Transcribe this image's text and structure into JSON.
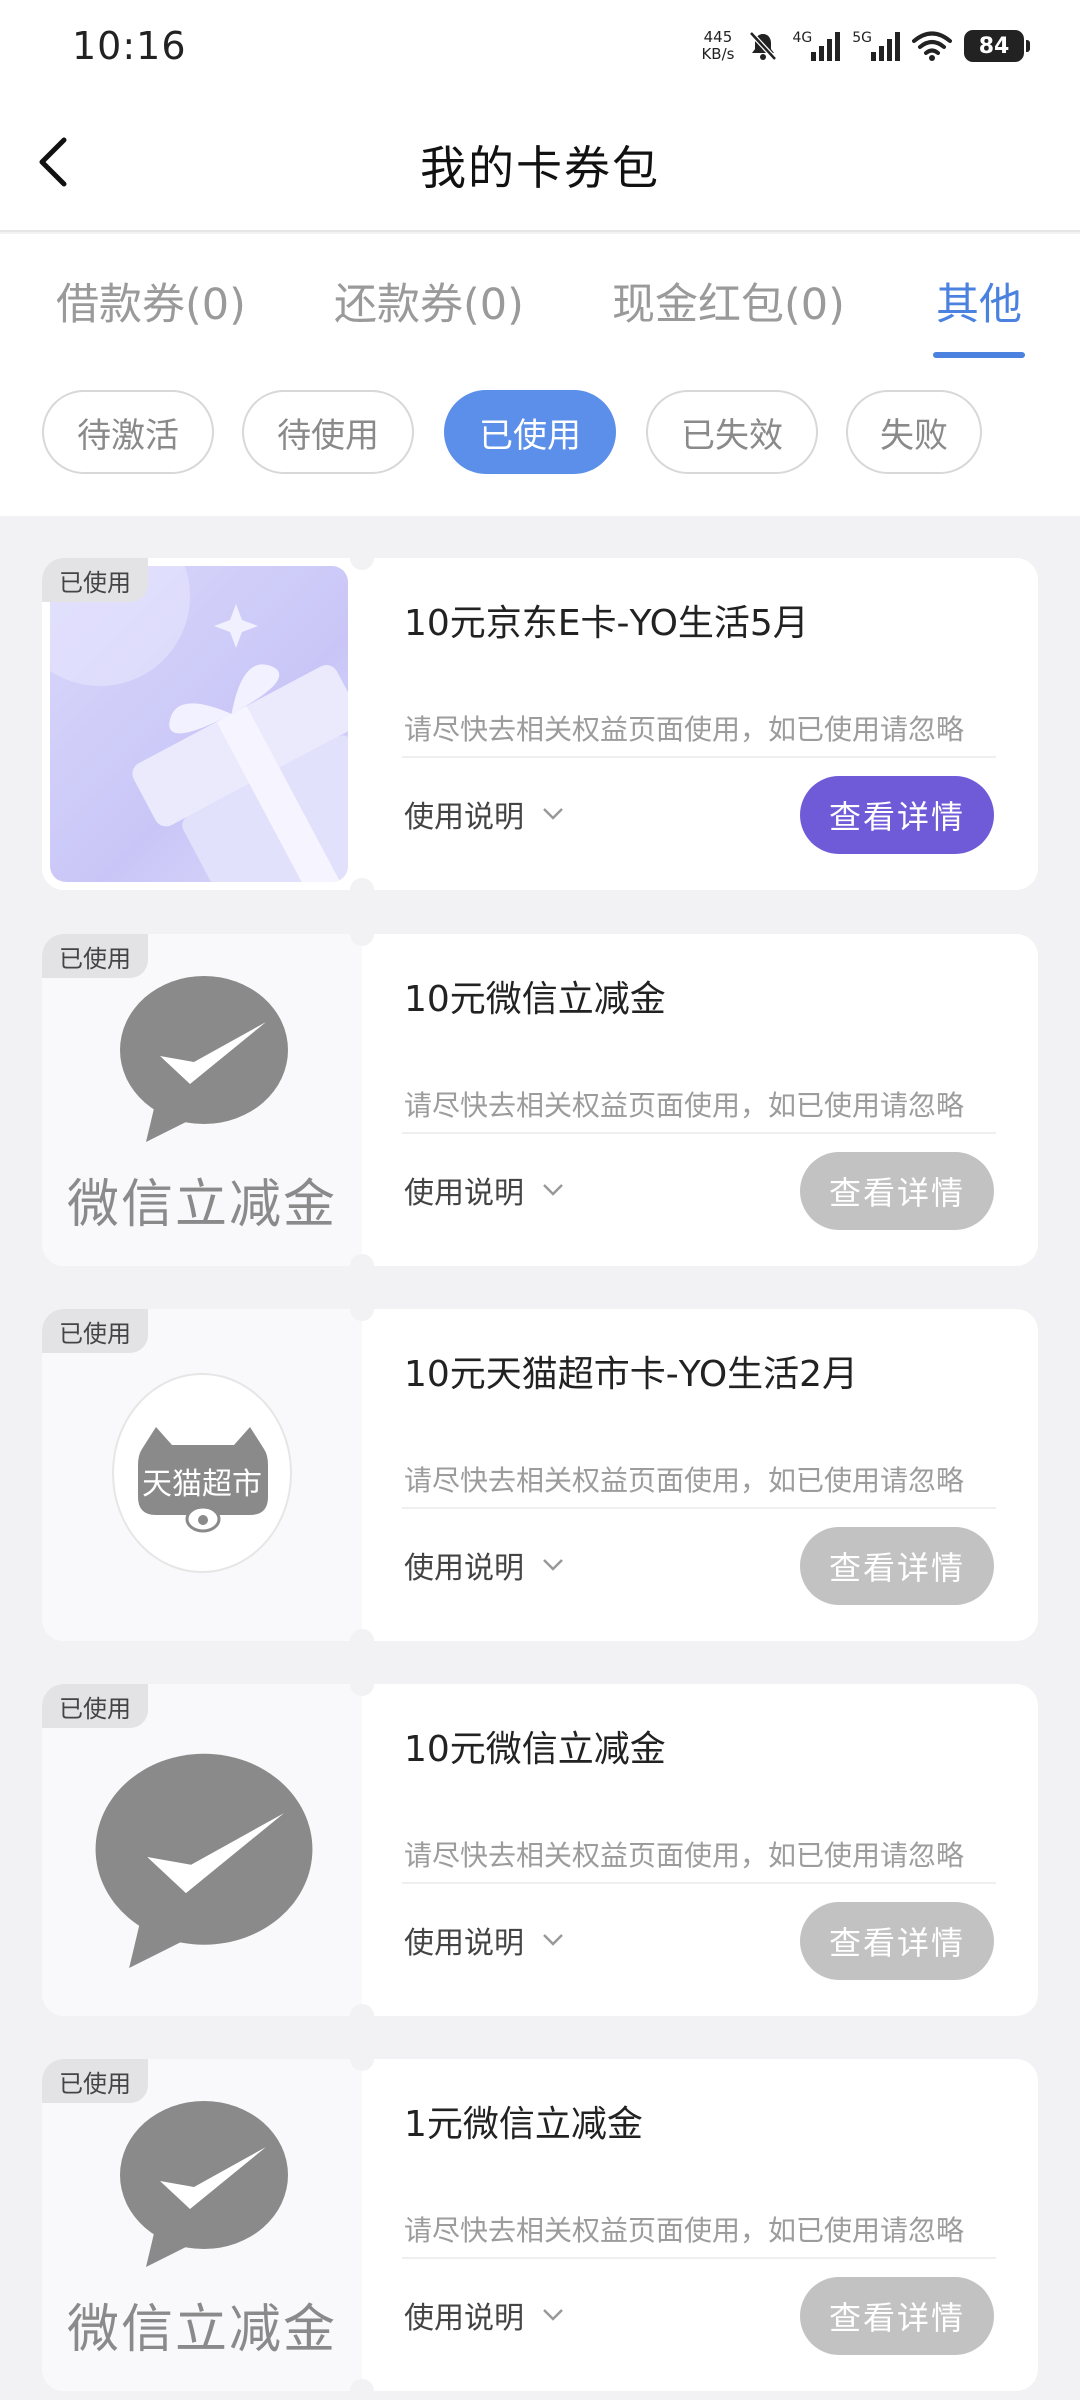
{
  "status_bar": {
    "time": "10:16",
    "net_speed_value": "445",
    "net_speed_unit": "KB/s",
    "signal_1_label": "4G",
    "signal_2_label": "5G",
    "battery": "84"
  },
  "nav": {
    "title": "我的卡券包"
  },
  "tabs": [
    {
      "label": "借款券(0)",
      "active": false
    },
    {
      "label": "还款券(0)",
      "active": false
    },
    {
      "label": "现金红包(0)",
      "active": false
    },
    {
      "label": "其他",
      "active": true
    }
  ],
  "filters": [
    {
      "label": "待激活",
      "active": false
    },
    {
      "label": "待使用",
      "active": false
    },
    {
      "label": "已使用",
      "active": true
    },
    {
      "label": "已失效",
      "active": false
    },
    {
      "label": "失败",
      "active": false
    }
  ],
  "cards": [
    {
      "tag": "已使用",
      "title": "10元京东E卡-YO生活5月",
      "desc": "请尽快去相关权益页面使用，如已使用请忽略",
      "usage": "使用说明",
      "button": "查看详情",
      "thumb": "gift-box-icon"
    },
    {
      "tag": "已使用",
      "title": "10元微信立减金",
      "desc": "请尽快去相关权益页面使用，如已使用请忽略",
      "usage": "使用说明",
      "button": "查看详情",
      "thumb": "wechat-icon",
      "thumb_label": "微信立减金"
    },
    {
      "tag": "已使用",
      "title": "10元天猫超市卡-YO生活2月",
      "desc": "请尽快去相关权益页面使用，如已使用请忽略",
      "usage": "使用说明",
      "button": "查看详情",
      "thumb": "tmall-icon",
      "thumb_label": "天猫超市"
    },
    {
      "tag": "已使用",
      "title": "10元微信立减金",
      "desc": "请尽快去相关权益页面使用，如已使用请忽略",
      "usage": "使用说明",
      "button": "查看详情",
      "thumb": "wechat-icon"
    },
    {
      "tag": "已使用",
      "title": "1元微信立减金",
      "desc": "请尽快去相关权益页面使用，如已使用请忽略",
      "usage": "使用说明",
      "button": "查看详情",
      "thumb": "wechat-icon",
      "thumb_label": "微信立减金"
    }
  ],
  "colors": {
    "accent": "#4b82e0",
    "chip_active": "#5b8fe9",
    "primary_button": "#6f5bd8",
    "disabled_button": "#c2c2c2",
    "wechat_gray": "#8a8a8a"
  }
}
